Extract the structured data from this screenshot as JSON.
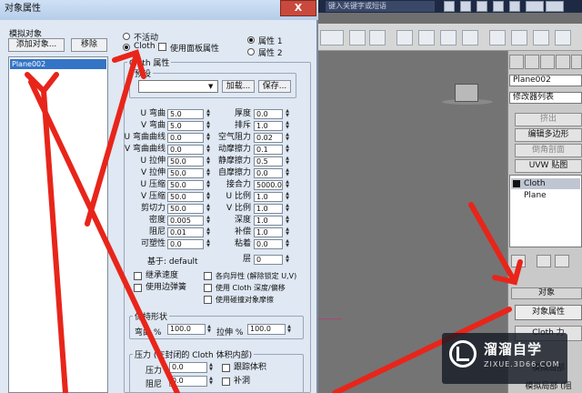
{
  "topbar": {
    "search_placeholder": "键入关键字或短语"
  },
  "command_panel": {
    "object_name": "Plane002",
    "modifier_list": "修改器列表",
    "buttons": [
      "挤出",
      "编辑多边形",
      "倒角剖面",
      "UVW 贴图"
    ],
    "stack": [
      "Cloth",
      "Plane"
    ],
    "rollout_object": "对象",
    "object_props_btn": "对象属性",
    "cloth_force_btn": "Cloth 力",
    "rollout_sel": "模拟局部",
    "rollout_sel2": "模拟局部 (阻"
  },
  "dialog": {
    "title": "对象属性",
    "close": "X",
    "sim_objects_label": "模拟对象",
    "add_objects_btn": "添加对象...",
    "remove_btn": "移除",
    "object_list": [
      "Plane002"
    ],
    "radio_inactive": "不活动",
    "radio_cloth": "Cloth",
    "use_panel_props": "使用面板属性",
    "prop1": "属性 1",
    "prop2": "属性 2",
    "cloth_props_title": "Cloth 属性",
    "presets_title": "预设",
    "load_btn": "加载...",
    "save_btn": "保存...",
    "left_params": [
      {
        "label": "U 弯曲",
        "value": "5.0"
      },
      {
        "label": "V 弯曲",
        "value": "5.0"
      },
      {
        "label": "U 弯曲曲线",
        "value": "0.0"
      },
      {
        "label": "V 弯曲曲线",
        "value": "0.0"
      },
      {
        "label": "U 拉伸",
        "value": "50.0"
      },
      {
        "label": "V 拉伸",
        "value": "50.0"
      },
      {
        "label": "U 压缩",
        "value": "50.0"
      },
      {
        "label": "V 压缩",
        "value": "50.0"
      },
      {
        "label": "剪切力",
        "value": "50.0"
      },
      {
        "label": "密度",
        "value": "0.005"
      },
      {
        "label": "阻尼",
        "value": "0.01"
      },
      {
        "label": "可塑性",
        "value": "0.0"
      }
    ],
    "right_params": [
      {
        "label": "厚度",
        "value": "0.0"
      },
      {
        "label": "排斥",
        "value": "1.0"
      },
      {
        "label": "空气阻力",
        "value": "0.02"
      },
      {
        "label": "动摩擦力",
        "value": "0.1"
      },
      {
        "label": "静摩擦力",
        "value": "0.5"
      },
      {
        "label": "自摩擦力",
        "value": "0.0"
      },
      {
        "label": "接合力",
        "value": "5000.0"
      },
      {
        "label": "U 比例",
        "value": "1.0"
      },
      {
        "label": "V 比例",
        "value": "1.0"
      },
      {
        "label": "深度",
        "value": "1.0"
      },
      {
        "label": "补偿",
        "value": "1.0"
      },
      {
        "label": "粘着",
        "value": "0.0"
      },
      {
        "label": "层",
        "value": "0"
      }
    ],
    "based_on": "基于: default",
    "checkbox_left": [
      "继承速度",
      "使用边弹簧"
    ],
    "checkbox_right": [
      "各向异性 (解除锁定 U,V)",
      "使用 Cloth 深度/偏移",
      "使用碰撞对象摩擦"
    ],
    "keep_shape_title": "保持形状",
    "bend_pct_label": "弯曲 %",
    "bend_pct": "100.0",
    "stretch_pct_label": "拉伸 %",
    "stretch_pct": "100.0",
    "pressure_title": "压力 (在封闭的 Cloth 体积内部)",
    "pressure_label": "压力",
    "pressure_value": "0.0",
    "damping_label": "阻尼",
    "damping_value": "0.0",
    "track_volume": "跟踪体积",
    "cap_holes": "补洞"
  },
  "watermark": {
    "title": "溜溜自学",
    "sub": "ZIXUE.3D66.COM"
  },
  "colors": {
    "annotation": "#e8251a",
    "selection": "#3474c6",
    "titlebar": "#b6cde8"
  }
}
